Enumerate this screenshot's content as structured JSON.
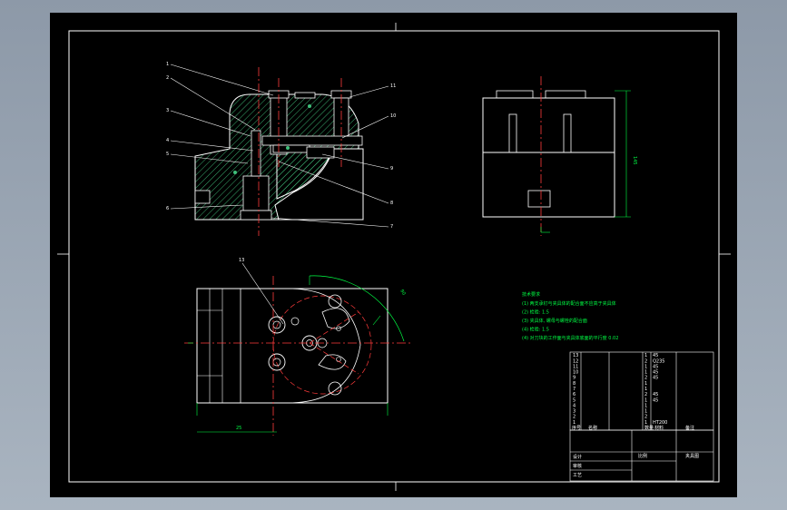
{
  "drawing": {
    "colors": {
      "line": "#ffffff",
      "hatch": "#3fc07a",
      "center": "#ff3b3b",
      "dim": "#00ff44",
      "text": "#00ff44",
      "canvas": "#000000",
      "background": "#98a4b2"
    },
    "callouts_left": [
      "1",
      "2",
      "3",
      "4",
      "5",
      "6"
    ],
    "callouts_right": [
      "11",
      "10",
      "9",
      "8",
      "7"
    ],
    "callout_plan": "13",
    "dim_overall_height": "145",
    "dim_plan_width": "25",
    "dim_angle": "90",
    "tech_req": {
      "title": "技术要求",
      "items": [
        "(1) 两支承钉与夹具体的配合面不应高于夹具体",
        "(2) 检验: 1.5",
        "(3) 夹具体, 螺母与螺栓的配合面",
        "(4) 检验: 1.5",
        "(4) 对刀块的工作面与夹具体底面的平行度 0.02"
      ]
    },
    "bom": {
      "headers": [
        "序号",
        "名称",
        "数量",
        "材料",
        "备注"
      ],
      "rows": [
        [
          "13",
          "",
          "1",
          "45",
          ""
        ],
        [
          "12",
          "",
          "2",
          "Q235",
          ""
        ],
        [
          "11",
          "",
          "1",
          "45",
          ""
        ],
        [
          "10",
          "",
          "1",
          "45",
          ""
        ],
        [
          "9",
          "",
          "2",
          "45",
          ""
        ],
        [
          "8",
          "",
          "1",
          "",
          ""
        ],
        [
          "7",
          "",
          "1",
          "",
          ""
        ],
        [
          "6",
          "",
          "2",
          "45",
          ""
        ],
        [
          "5",
          "",
          "1",
          "45",
          ""
        ],
        [
          "4",
          "",
          "1",
          "",
          ""
        ],
        [
          "3",
          "",
          "1",
          "",
          ""
        ],
        [
          "2",
          "",
          "2",
          "",
          ""
        ],
        [
          "1",
          "",
          "1",
          "HT200",
          ""
        ]
      ]
    },
    "title_block": {
      "name": "夹具图",
      "scale_label": "比例",
      "labels": [
        "设计",
        "审核",
        "工艺"
      ]
    }
  }
}
